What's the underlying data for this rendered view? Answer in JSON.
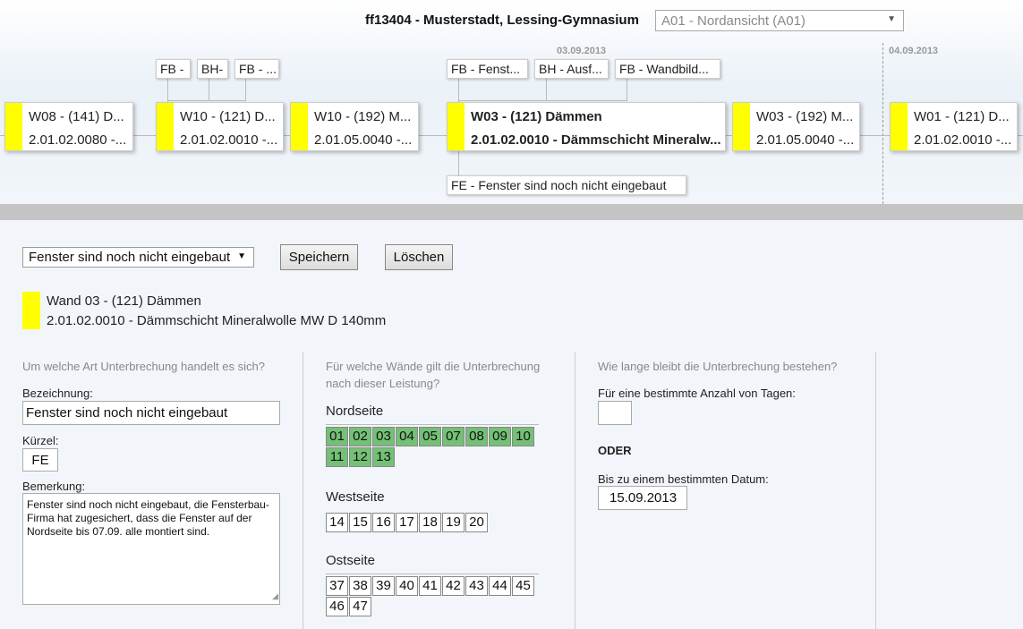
{
  "header": {
    "title": "ff13404 - Musterstadt, Lessing-Gymnasium",
    "view_select": "A01 - Nordansicht (A01)"
  },
  "timeline": {
    "dates": [
      "03.09.2013",
      "04.09.2013"
    ],
    "cards": [
      {
        "line1": "W08 - (141) D...",
        "line2": "2.01.02.0080 -..."
      },
      {
        "line1": "W10 - (121) D...",
        "line2": "2.01.02.0010 -..."
      },
      {
        "line1": "W10 - (192) M...",
        "line2": "2.01.05.0040 -..."
      },
      {
        "line1": "W03 - (121) Dämmen",
        "line2": "2.01.02.0010 - Dämmschicht Mineralw..."
      },
      {
        "line1": "W03 - (192) M...",
        "line2": "2.01.05.0040 -..."
      },
      {
        "line1": "W01 - (121) D...",
        "line2": "2.01.02.0010 -..."
      }
    ],
    "tags": [
      "FB -",
      "BH-",
      "FB - ...",
      "FB - Fenst...",
      "BH - Ausf...",
      "FB - Wandbild...",
      "FE - Fenster sind noch nicht eingebaut"
    ]
  },
  "controls": {
    "interruption_select": "Fenster sind noch nicht eingebaut",
    "save_label": "Speichern",
    "delete_label": "Löschen"
  },
  "selected": {
    "line1": "Wand 03 - (121) Dämmen",
    "line2": "2.01.02.0010 - Dämmschicht Mineralwolle MW D 140mm"
  },
  "form": {
    "col1_head": "Um welche Art Unterbrechung handelt es sich?",
    "name_label": "Bezeichnung:",
    "name_value": "Fenster sind noch nicht eingebaut",
    "short_label": "Kürzel:",
    "short_value": "FE",
    "note_label": "Bemerkung:",
    "note_value": "Fenster sind noch nicht eingebaut, die Fensterbau-Firma hat zugesichert, dass die Fenster auf der Nordseite bis 07.09. alle montiert sind.",
    "col2_head": "Für welche Wände gilt die Unterbrechung nach dieser Leistung?",
    "col3_head": "Wie lange bleibt die Unterbrechung bestehen?",
    "days_label": "Für eine bestimmte Anzahl von Tagen:",
    "days_value": "",
    "or_label": "ODER",
    "date_label": "Bis zu einem bestimmten Datum:",
    "date_value": "15.09.2013"
  },
  "walls": {
    "north": {
      "title": "Nordseite",
      "items": [
        "01",
        "02",
        "03",
        "04",
        "05",
        "07",
        "08",
        "09",
        "10",
        "11",
        "12",
        "13"
      ],
      "selected": true
    },
    "west": {
      "title": "Westseite",
      "items": [
        "14",
        "15",
        "16",
        "17",
        "18",
        "19",
        "20"
      ],
      "selected": false
    },
    "east": {
      "title": "Ostseite",
      "items": [
        "37",
        "38",
        "39",
        "40",
        "41",
        "42",
        "43",
        "44",
        "45",
        "46",
        "47"
      ],
      "selected": false
    }
  },
  "colors": {
    "card_accent": "#ffff00",
    "wall_selected": "#74c076"
  }
}
